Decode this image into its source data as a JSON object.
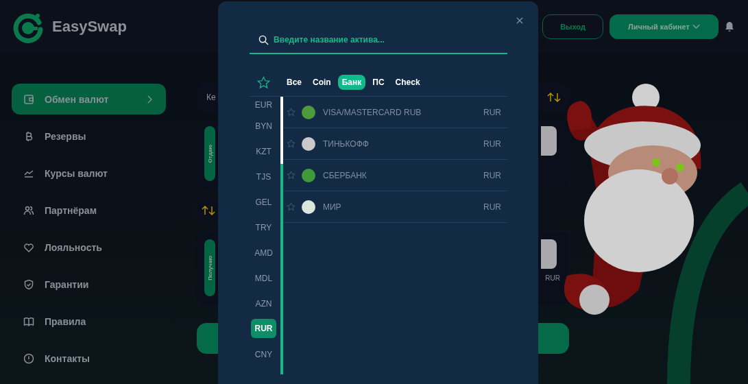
{
  "header": {
    "logo_text": "EasySwap",
    "logout_button": "Выход",
    "account_button": "Личный кабинет"
  },
  "sidebar": {
    "items": [
      {
        "label": "Обмен валют",
        "selected": true
      },
      {
        "label": "Резервы",
        "selected": false
      },
      {
        "label": "Курсы валют",
        "selected": false
      },
      {
        "label": "Партнёрам",
        "selected": false
      },
      {
        "label": "Лояльность",
        "selected": false
      },
      {
        "label": "Гарантии",
        "selected": false
      },
      {
        "label": "Правила",
        "selected": false
      },
      {
        "label": "Контакты",
        "selected": false
      }
    ]
  },
  "exchange": {
    "section_label": "Ке",
    "give_label": "Отдаю",
    "get_label": "Получаю",
    "get_currency": "RUR"
  },
  "modal": {
    "search": {
      "placeholder": "Введите название актива..."
    },
    "categories": [
      {
        "label": "Все",
        "selected": false
      },
      {
        "label": "Coin",
        "selected": false
      },
      {
        "label": "Банк",
        "selected": true
      },
      {
        "label": "ПС",
        "selected": false
      },
      {
        "label": "Check",
        "selected": false
      }
    ],
    "currencies": [
      {
        "label": "EUR",
        "selected": false
      },
      {
        "label": "BYN",
        "selected": false
      },
      {
        "label": "KZT",
        "selected": false
      },
      {
        "label": "TJS",
        "selected": false
      },
      {
        "label": "GEL",
        "selected": false
      },
      {
        "label": "TRY",
        "selected": false
      },
      {
        "label": "AMD",
        "selected": false
      },
      {
        "label": "MDL",
        "selected": false
      },
      {
        "label": "AZN",
        "selected": false
      },
      {
        "label": "RUR",
        "selected": true
      },
      {
        "label": "CNY",
        "selected": false
      }
    ],
    "assets": [
      {
        "name": "VISA/MASTERCARD RUB",
        "currency": "RUR",
        "color": "#4c9a3c"
      },
      {
        "name": "ТИНЬКОФФ",
        "currency": "RUR",
        "color": "#c9c9c9"
      },
      {
        "name": "СБЕРБАНК",
        "currency": "RUR",
        "color": "#3e9a3a"
      },
      {
        "name": "МИР",
        "currency": "RUR",
        "color": "#d8e6dc"
      }
    ]
  }
}
